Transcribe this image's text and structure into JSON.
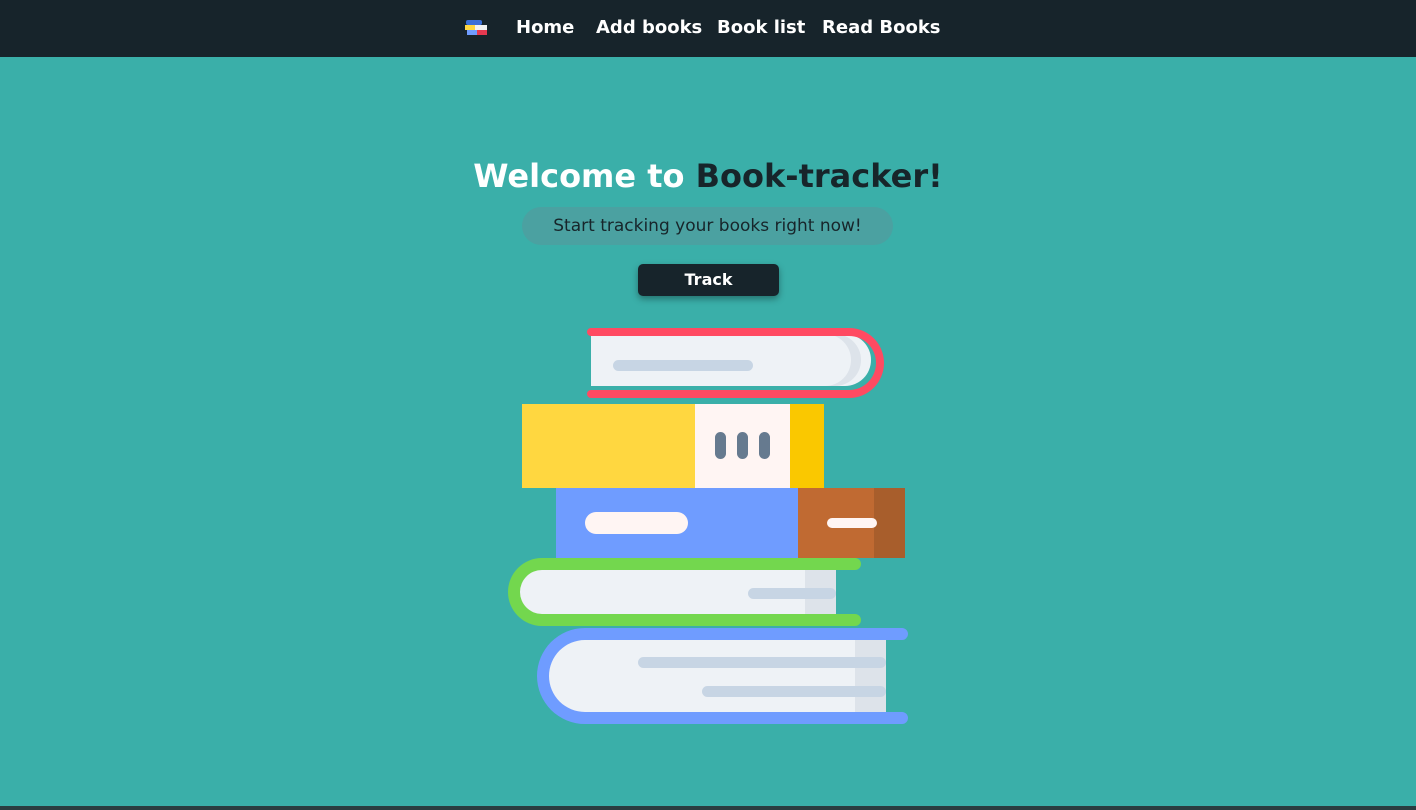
{
  "nav": {
    "logo_icon": "books-stack-icon",
    "links": [
      {
        "label": "Home"
      },
      {
        "label": "Add books"
      },
      {
        "label": "Book list"
      },
      {
        "label": "Read Books"
      }
    ]
  },
  "hero": {
    "title_prefix": "Welcome to ",
    "title_brand": "Book-tracker!",
    "subtitle": "Start tracking your books right now!",
    "button_label": "Track",
    "illustration_icon": "book-stack-illustration"
  },
  "colors": {
    "background": "#3aafa9",
    "navbar": "#17242b",
    "brand_text": "#17252a",
    "title_text": "#feffff",
    "subtitle_pill": "#4ba1a1",
    "button": "#17242b"
  }
}
